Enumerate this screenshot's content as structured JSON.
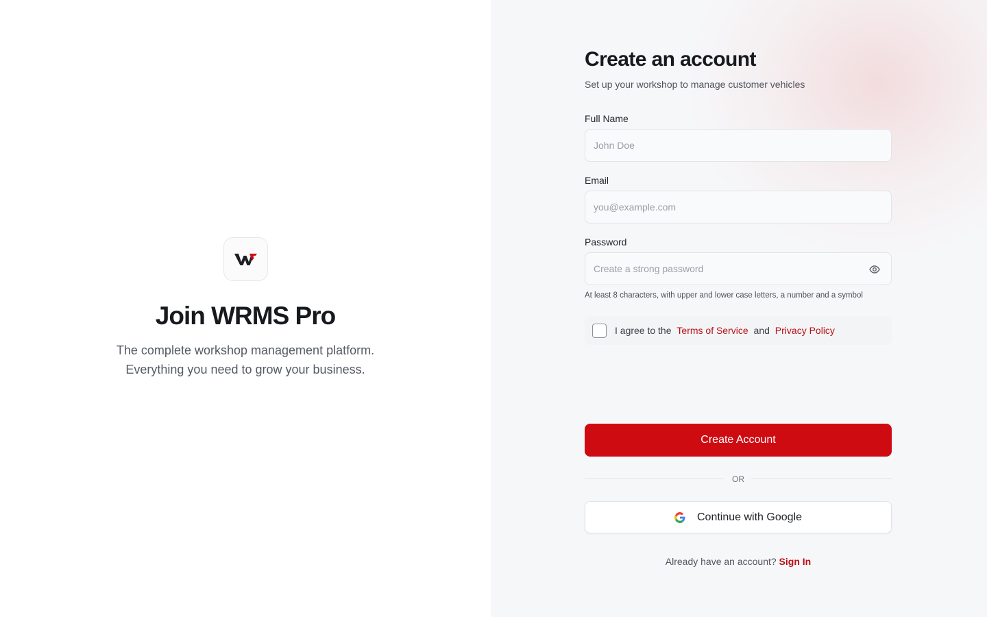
{
  "brand": {
    "logo_text": "W",
    "title": "Join WRMS Pro",
    "subtitle_line1": "The complete workshop management platform.",
    "subtitle_line2": "Everything you need to grow your business."
  },
  "form": {
    "title": "Create an account",
    "subtitle": "Set up your workshop to manage customer vehicles",
    "full_name": {
      "label": "Full Name",
      "placeholder": "John Doe",
      "value": ""
    },
    "email": {
      "label": "Email",
      "placeholder": "you@example.com",
      "value": ""
    },
    "password": {
      "label": "Password",
      "placeholder": "Create a strong password",
      "value": "",
      "toggle_icon": "eye-icon"
    },
    "password_hint": "At least 8 characters, with upper and lower case letters, a number and a symbol",
    "agree": {
      "prefix": "I agree to the",
      "terms_link": "Terms of Service",
      "joiner": "and",
      "privacy_link": "Privacy Policy",
      "checked": false
    },
    "submit_label": "Create Account",
    "divider_text": "OR",
    "google_label": "Continue with Google",
    "signin_prompt": "Already have an account?",
    "signin_link": "Sign In"
  },
  "colors": {
    "accent": "#cf0b12",
    "link": "#b80f14",
    "text": "#16191d",
    "muted": "#4f555c",
    "panel_bg": "#f6f7f9"
  }
}
